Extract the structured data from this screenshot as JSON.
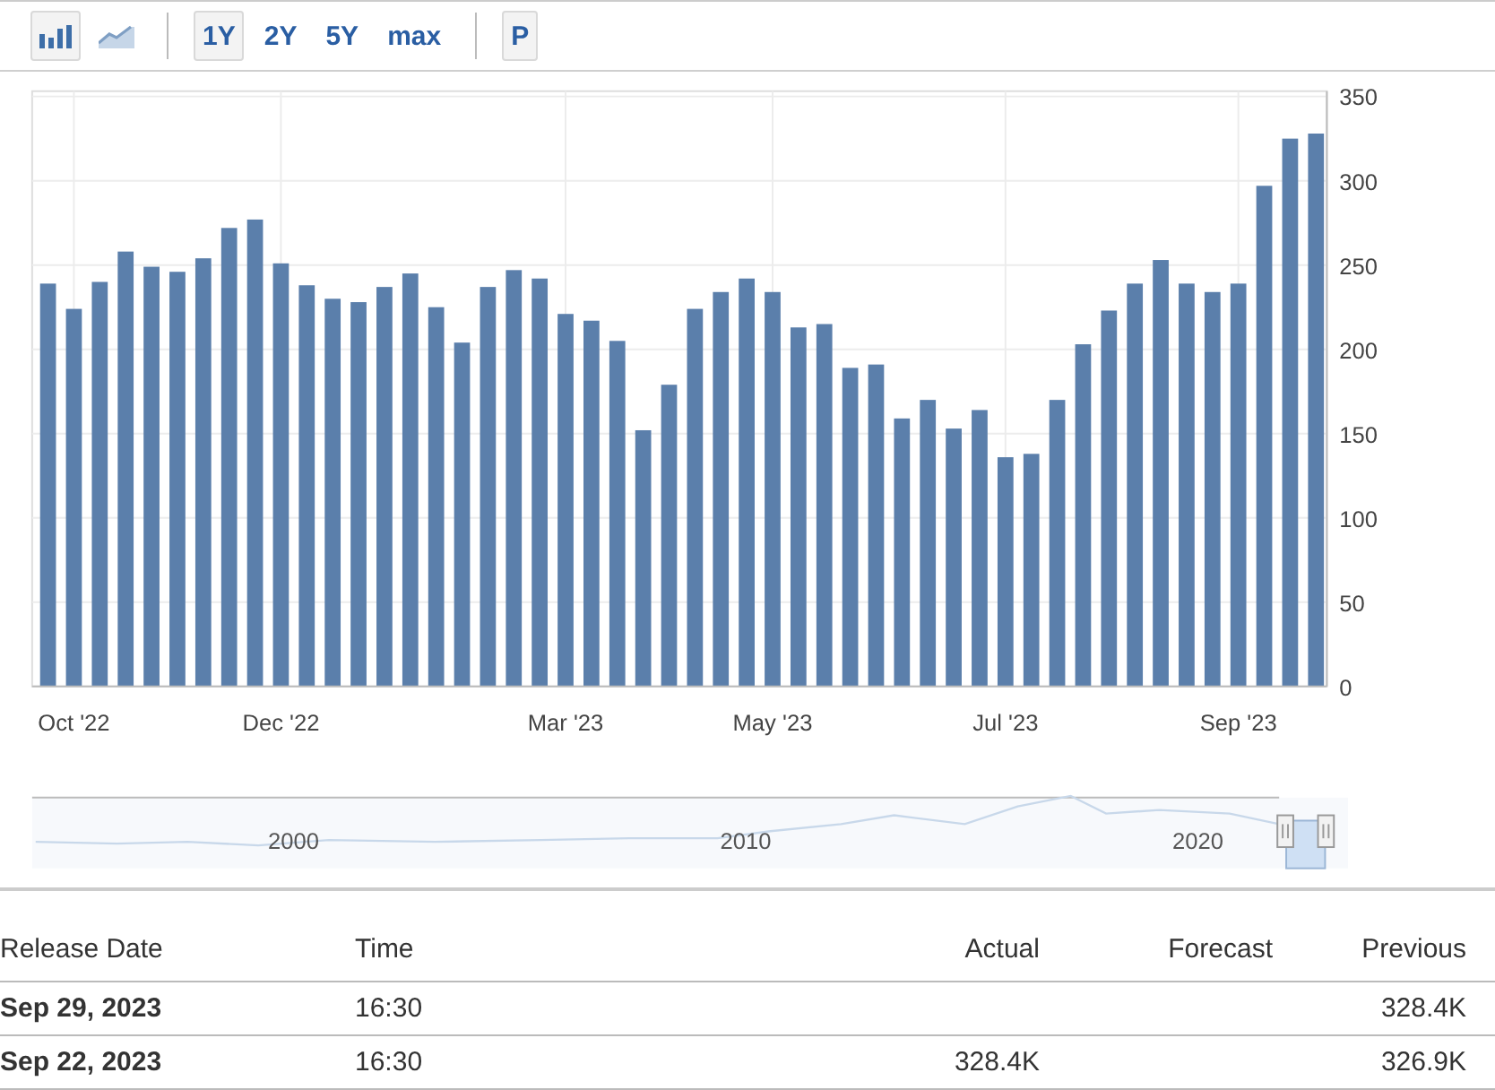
{
  "toolbar": {
    "chart_types": [
      {
        "kind": "bar",
        "selected": true
      },
      {
        "kind": "line",
        "selected": false
      }
    ],
    "ranges": [
      {
        "label": "1Y",
        "selected": true
      },
      {
        "label": "2Y",
        "selected": false
      },
      {
        "label": "5Y",
        "selected": false
      },
      {
        "label": "max",
        "selected": false
      }
    ],
    "extra_button": "P"
  },
  "chart": {
    "chart_data": {
      "type": "bar",
      "categories": [
        null,
        "Oct '22",
        null,
        null,
        null,
        null,
        null,
        null,
        null,
        "Dec '22",
        null,
        null,
        null,
        null,
        null,
        null,
        null,
        null,
        null,
        null,
        "Mar '23",
        null,
        null,
        null,
        null,
        null,
        null,
        null,
        "May '23",
        null,
        null,
        null,
        null,
        null,
        null,
        null,
        null,
        "Jul '23",
        null,
        null,
        null,
        null,
        null,
        null,
        null,
        null,
        "Sep '23",
        null,
        null,
        null
      ],
      "series": [
        {
          "color": "#5b7fab",
          "values": [
            239,
            224,
            240,
            258,
            249,
            246,
            254,
            272,
            277,
            251,
            238,
            230,
            228,
            237,
            245,
            225,
            204,
            237,
            247,
            242,
            221,
            217,
            205,
            152,
            179,
            224,
            234,
            242,
            234,
            213,
            215,
            189,
            191,
            159,
            170,
            153,
            164,
            136,
            138,
            170,
            203,
            223,
            239,
            253,
            239,
            234,
            239,
            297,
            325,
            328
          ]
        }
      ],
      "grid": true,
      "ylim": [
        0,
        350
      ],
      "yticks": [
        0,
        50,
        100,
        150,
        200,
        250,
        300,
        350
      ]
    }
  },
  "navigator": {
    "years": [
      "2000",
      "2010",
      "2020"
    ]
  },
  "table": {
    "columns": [
      "Release Date",
      "Time",
      "Actual",
      "Forecast",
      "Previous"
    ],
    "rows": [
      {
        "date": "Sep 29, 2023",
        "time": "16:30",
        "previous": "328.4K"
      },
      {
        "date": "Sep 22, 2023",
        "time": "16:30",
        "actual": "328.4K",
        "previous": "326.9K"
      }
    ]
  }
}
